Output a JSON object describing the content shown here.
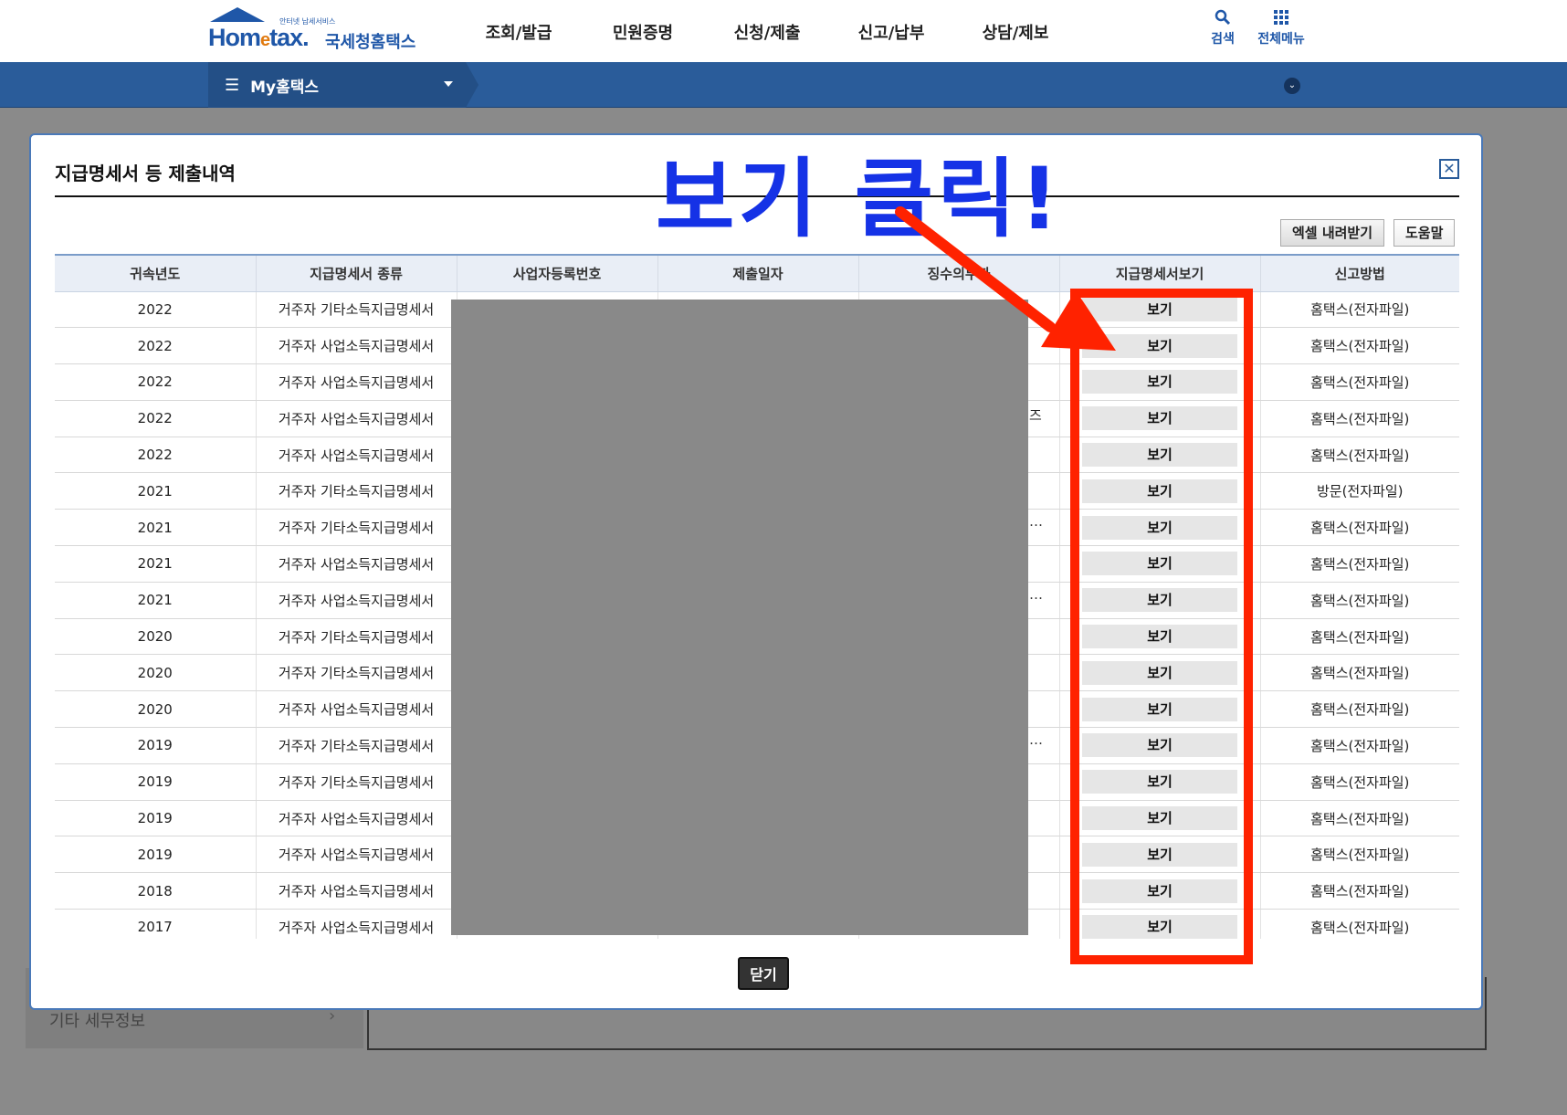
{
  "header": {
    "logo_small": "안터넷 납세서비스",
    "logo_brand_a": "Hom",
    "logo_brand_e": "e",
    "logo_brand_b": "tax.",
    "logo_kor": "국세청홈택스",
    "nav": [
      "조회/발급",
      "민원증명",
      "신청/제출",
      "신고/납부",
      "상담/제보"
    ],
    "search_label": "검색",
    "all_menu_label": "전체메뉴"
  },
  "band": {
    "my_menu": "My홈택스"
  },
  "background": {
    "side_item": "기타 세무정보"
  },
  "modal": {
    "title": "지급명세서 등 제출내역",
    "excel_button": "엑셀 내려받기",
    "help_button": "도움말",
    "close_button": "닫기",
    "columns": [
      "귀속년도",
      "지급명세서 종류",
      "사업자등록번호",
      "제출일자",
      "징수의무자",
      "지급명세서보기",
      "신고방법"
    ],
    "rows": [
      {
        "year": "2022",
        "type": "거주자 기타소득지급명세서",
        "view": "보기",
        "method": "홈택스(전자파일)"
      },
      {
        "year": "2022",
        "type": "거주자 사업소득지급명세서",
        "view": "보기",
        "method": "홈택스(전자파일)"
      },
      {
        "year": "2022",
        "type": "거주자 사업소득지급명세서",
        "view": "보기",
        "method": "홈택스(전자파일)"
      },
      {
        "year": "2022",
        "type": "거주자 사업소득지급명세서",
        "view": "보기",
        "method": "홈택스(전자파일)"
      },
      {
        "year": "2022",
        "type": "거주자 사업소득지급명세서",
        "view": "보기",
        "method": "홈택스(전자파일)"
      },
      {
        "year": "2021",
        "type": "거주자 기타소득지급명세서",
        "view": "보기",
        "method": "방문(전자파일)"
      },
      {
        "year": "2021",
        "type": "거주자 기타소득지급명세서",
        "view": "보기",
        "method": "홈택스(전자파일)"
      },
      {
        "year": "2021",
        "type": "거주자 사업소득지급명세서",
        "view": "보기",
        "method": "홈택스(전자파일)"
      },
      {
        "year": "2021",
        "type": "거주자 사업소득지급명세서",
        "view": "보기",
        "method": "홈택스(전자파일)"
      },
      {
        "year": "2020",
        "type": "거주자 기타소득지급명세서",
        "view": "보기",
        "method": "홈택스(전자파일)"
      },
      {
        "year": "2020",
        "type": "거주자 기타소득지급명세서",
        "view": "보기",
        "method": "홈택스(전자파일)"
      },
      {
        "year": "2020",
        "type": "거주자 사업소득지급명세서",
        "view": "보기",
        "method": "홈택스(전자파일)"
      },
      {
        "year": "2019",
        "type": "거주자 기타소득지급명세서",
        "view": "보기",
        "method": "홈택스(전자파일)"
      },
      {
        "year": "2019",
        "type": "거주자 기타소득지급명세서",
        "view": "보기",
        "method": "홈택스(전자파일)"
      },
      {
        "year": "2019",
        "type": "거주자 사업소득지급명세서",
        "view": "보기",
        "method": "홈택스(전자파일)"
      },
      {
        "year": "2019",
        "type": "거주자 사업소득지급명세서",
        "view": "보기",
        "method": "홈택스(전자파일)"
      },
      {
        "year": "2018",
        "type": "거주자 사업소득지급명세서",
        "view": "보기",
        "method": "홈택스(전자파일)"
      },
      {
        "year": "2017",
        "type": "거주자 사업소득지급명세서",
        "view": "보기",
        "method": "홈택스(전자파일)"
      }
    ],
    "partial_texts": {
      "row4_tail": "즈",
      "ellipsis": "…"
    }
  },
  "annotation": {
    "text": "보기 클릭!",
    "text_color": "#1532e6",
    "highlight_color": "#ff2200"
  },
  "icons": {
    "search": "search-icon",
    "grid": "grid-icon",
    "close": "close-icon",
    "menu": "hamburger-icon"
  },
  "colors": {
    "brand_blue": "#1f57a8",
    "band_blue": "#2a5c9a",
    "accent_orange": "#e07a10"
  }
}
